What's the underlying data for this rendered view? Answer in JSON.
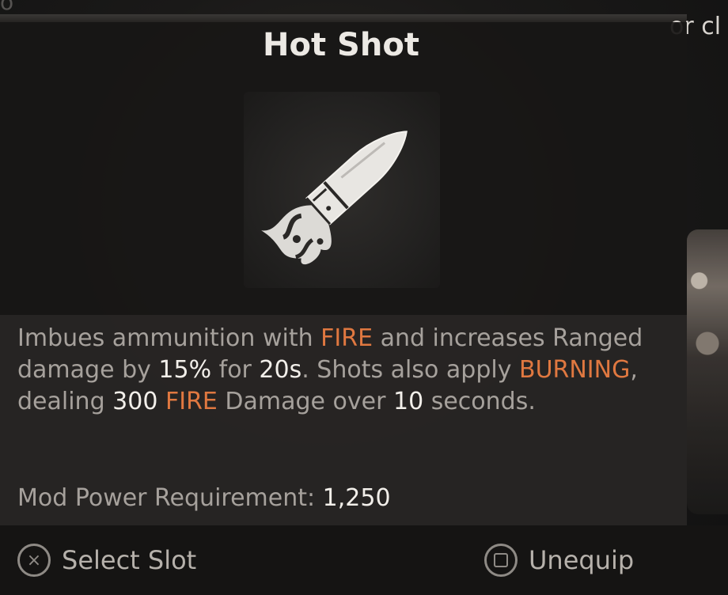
{
  "background": {
    "partial_text": "o",
    "corner_text": "or cl"
  },
  "mod": {
    "title": "Hot Shot",
    "icon": "bullet-icon",
    "description_parts": [
      {
        "text": "Imbues ammunition with ",
        "style": "normal"
      },
      {
        "text": "FIRE",
        "style": "highlight"
      },
      {
        "text": " and increases Ranged damage by ",
        "style": "normal"
      },
      {
        "text": "15%",
        "style": "white"
      },
      {
        "text": " for ",
        "style": "normal"
      },
      {
        "text": "20s",
        "style": "white"
      },
      {
        "text": ". Shots also apply ",
        "style": "normal"
      },
      {
        "text": "BURNING",
        "style": "highlight"
      },
      {
        "text": ", dealing ",
        "style": "normal"
      },
      {
        "text": "300",
        "style": "white"
      },
      {
        "text": " ",
        "style": "normal"
      },
      {
        "text": "FIRE",
        "style": "highlight"
      },
      {
        "text": " Damage over ",
        "style": "normal"
      },
      {
        "text": "10",
        "style": "white"
      },
      {
        "text": " seconds.",
        "style": "normal"
      }
    ],
    "requirement_label": "Mod Power Requirement:",
    "requirement_value": "1,250"
  },
  "footer": {
    "select_label": "Select Slot",
    "select_glyph": "×",
    "select_icon": "cross-button-icon",
    "unequip_label": "Unequip",
    "unequip_icon": "square-button-icon"
  },
  "colors": {
    "highlight": "#e07840",
    "text": "#a6a19c",
    "value": "#f2efea"
  }
}
